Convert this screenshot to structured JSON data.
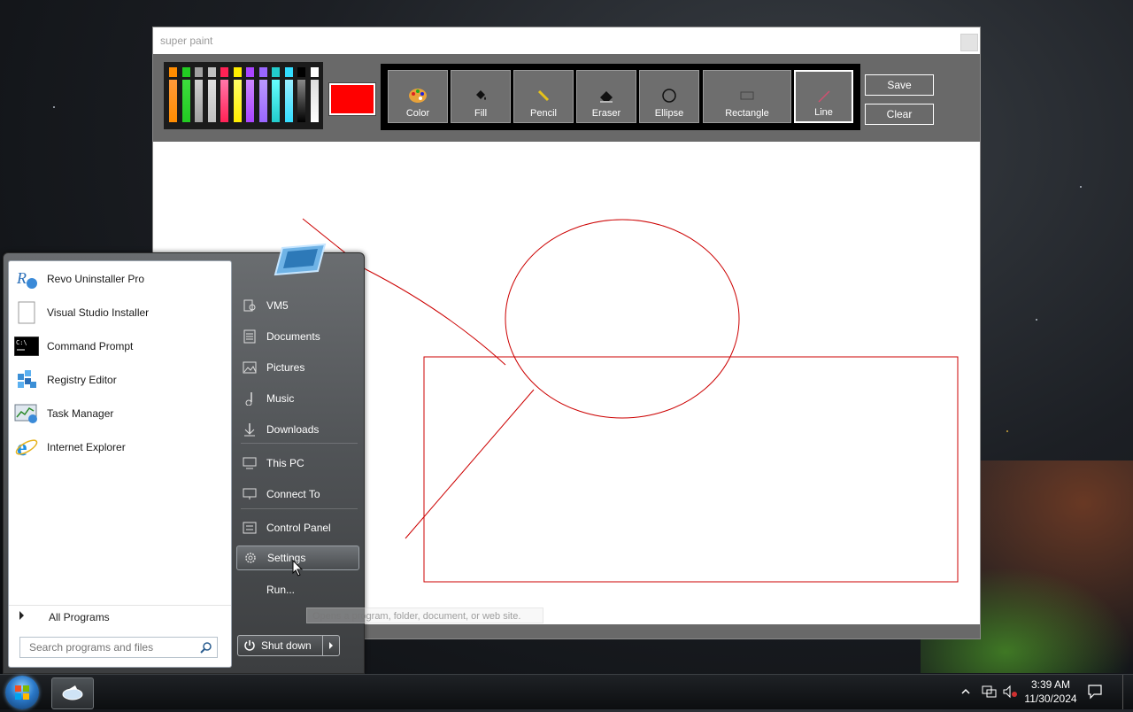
{
  "paint": {
    "title": "super paint",
    "current_color": "#ff0000",
    "palette_colors": [
      "#ff8c00",
      "#22cc22",
      "#a0a0a0",
      "#c0c0c0",
      "#ff2255",
      "#ffee00",
      "#aa44ff",
      "#9966ff",
      "#22cccc",
      "#33ddff",
      "#000000",
      "#ffffff"
    ],
    "tools": [
      {
        "label": "Color",
        "icon": "palette-icon"
      },
      {
        "label": "Fill",
        "icon": "fill-bucket-icon"
      },
      {
        "label": "Pencil",
        "icon": "pencil-icon"
      },
      {
        "label": "Eraser",
        "icon": "eraser-icon"
      },
      {
        "label": "Ellipse",
        "icon": "ellipse-icon"
      },
      {
        "label": "Rectangle",
        "icon": "rectangle-icon"
      },
      {
        "label": "Line",
        "icon": "line-icon"
      }
    ],
    "active_tool": "Line",
    "save_label": "Save",
    "clear_label": "Clear",
    "stroke_color": "#cc0000"
  },
  "start_menu": {
    "programs": [
      {
        "label": "Revo Uninstaller Pro",
        "icon": "revo-uninstaller-icon"
      },
      {
        "label": "Visual Studio Installer",
        "icon": "blank-document-icon"
      },
      {
        "label": "Command Prompt",
        "icon": "command-prompt-icon"
      },
      {
        "label": "Registry Editor",
        "icon": "registry-editor-icon"
      },
      {
        "label": "Task Manager",
        "icon": "task-manager-icon"
      },
      {
        "label": "Internet Explorer",
        "icon": "internet-explorer-icon"
      }
    ],
    "all_programs": "All Programs",
    "search_placeholder": "Search programs and files",
    "places": [
      {
        "label": "VM5",
        "icon": "user-folder-icon"
      },
      {
        "label": "Documents",
        "icon": "documents-icon"
      },
      {
        "label": "Pictures",
        "icon": "pictures-icon"
      },
      {
        "label": "Music",
        "icon": "music-icon"
      },
      {
        "label": "Downloads",
        "icon": "downloads-icon"
      },
      {
        "label": "This PC",
        "icon": "computer-icon"
      },
      {
        "label": "Connect To",
        "icon": "connect-to-icon"
      },
      {
        "label": "Control Panel",
        "icon": "control-panel-icon"
      },
      {
        "label": "Settings",
        "icon": "settings-gear-icon"
      },
      {
        "label": "Run...",
        "icon": "run-icon"
      }
    ],
    "hovered_item": "Settings",
    "shutdown_label": "Shut down",
    "tooltip": "Opens a program, folder, document, or web site."
  },
  "taskbar": {
    "time": "3:39 AM",
    "date": "11/30/2024"
  }
}
